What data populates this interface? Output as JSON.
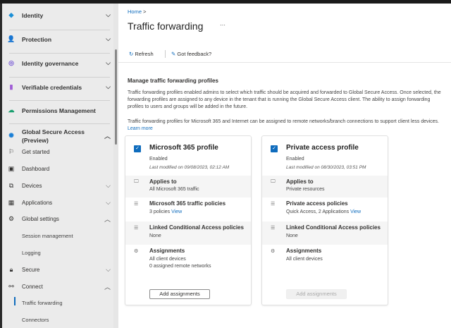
{
  "sidebar": {
    "top_items": [
      {
        "label": "Identity",
        "icon": "identity-diamond-icon"
      },
      {
        "label": "Protection",
        "icon": "protection-user-icon"
      },
      {
        "label": "Identity governance",
        "icon": "identity-governance-icon"
      },
      {
        "label": "Verifiable credentials",
        "icon": "verifiable-credentials-icon"
      },
      {
        "label": "Permissions Management",
        "icon": "cloud-icon"
      }
    ],
    "gsa": {
      "label": "Global Secure Access",
      "label2": "(Preview)"
    },
    "items": [
      {
        "label": "Get started",
        "icon": "flag-icon"
      },
      {
        "label": "Dashboard",
        "icon": "dashboard-icon"
      },
      {
        "label": "Devices",
        "icon": "devices-icon"
      },
      {
        "label": "Applications",
        "icon": "applications-icon"
      },
      {
        "label": "Global settings",
        "icon": "gear-icon"
      },
      {
        "label": "Session management"
      },
      {
        "label": "Logging"
      },
      {
        "label": "Secure",
        "icon": "lock-icon"
      },
      {
        "label": "Connect",
        "icon": "connect-icon"
      },
      {
        "label": "Traffic forwarding"
      },
      {
        "label": "Connectors"
      }
    ]
  },
  "header": {
    "breadcrumb": "Home",
    "breadcrumb_sep": ">",
    "title": "Traffic forwarding",
    "more": "···"
  },
  "toolbar": {
    "refresh": "Refresh",
    "feedback": "Got feedback?"
  },
  "intro": {
    "heading": "Manage traffic forwarding profiles",
    "p1": "Traffic forwarding profiles enabled admins to select which traffic should be acquired and forwarded to Global Secure Access. Once selected, the forwarding profiles are assigned to any device in the tenant that is running the Global Secure Access client. The ability to assign forwarding profiles to users and groups will be added in the future.",
    "p2": "Traffic forwarding profiles for Microsoft 365 and Internet can be assigned to remote networks/branch connections to support client less devices.",
    "learn_more": "Learn more"
  },
  "cards": [
    {
      "title": "Microsoft 365 profile",
      "checked": true,
      "status": "Enabled",
      "modified": "Last modified on 09/08/2023, 02:12 AM",
      "applies_title": "Applies to",
      "applies_value": "All Microsoft 365 traffic",
      "policies_title": "Microsoft 365 traffic policies",
      "policies_value": "3 policies",
      "policies_link": "View",
      "linked_title": "Linked Conditional Access policies",
      "linked_value": "None",
      "assign_title": "Assignments",
      "assign_value1": "All client devices",
      "assign_value2": "0 assigned remote networks",
      "button": "Add assignments",
      "button_enabled": true
    },
    {
      "title": "Private access profile",
      "checked": true,
      "status": "Enabled",
      "modified": "Last modified on 08/30/2023, 03:51 PM",
      "applies_title": "Applies to",
      "applies_value": "Private resources",
      "policies_title": "Private access policies",
      "policies_value": "Quick Access, 2 Applications",
      "policies_link": "View",
      "linked_title": "Linked Conditional Access policies",
      "linked_value": "None",
      "assign_title": "Assignments",
      "assign_value1": "All client devices",
      "button": "Add assignments",
      "button_enabled": false
    }
  ]
}
